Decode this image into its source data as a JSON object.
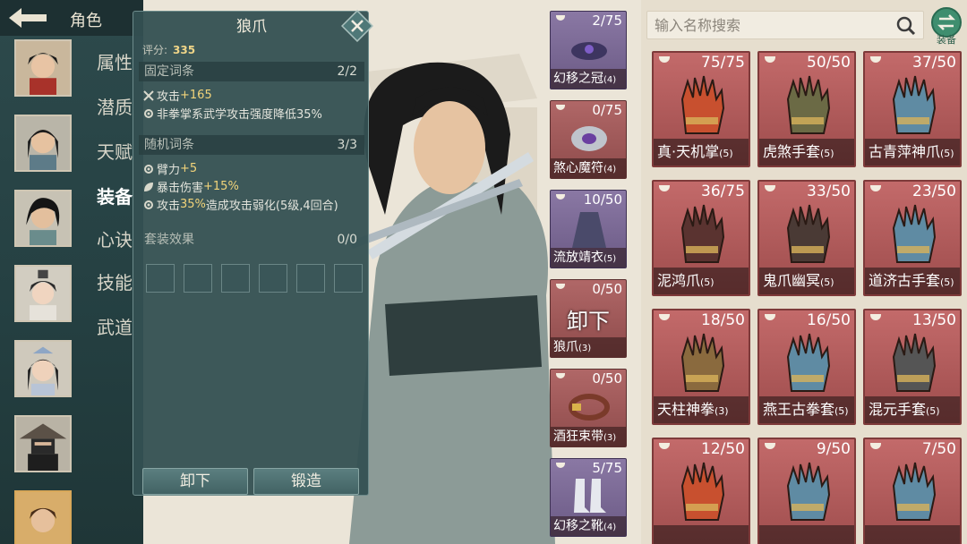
{
  "header": {
    "title": "角色"
  },
  "sidebar": {
    "nav": [
      "属性",
      "潜质",
      "天赋",
      "装备",
      "心诀",
      "技能",
      "武道"
    ],
    "active_index": 3
  },
  "detail": {
    "title": "狼爪",
    "score_label": "评分:",
    "score_value": "335",
    "fixed_header": "固定词条",
    "fixed_count": "2/2",
    "fixed": [
      {
        "prefix": "攻击",
        "value": "+165",
        "suffix": ""
      },
      {
        "prefix": "非拳掌系武学攻击强度降低35%",
        "value": "",
        "suffix": ""
      }
    ],
    "random_header": "随机词条",
    "random_count": "3/3",
    "random": [
      {
        "prefix": "臂力",
        "value": "+5",
        "suffix": ""
      },
      {
        "prefix": "暴击伤害",
        "value": "+15%",
        "suffix": ""
      },
      {
        "prefix": "攻击",
        "value": "35%",
        "suffix": "造成攻击弱化(5级,4回合)"
      }
    ],
    "set_header": "套装效果",
    "set_count": "0/0",
    "buttons": {
      "unequip": "卸下",
      "forge": "锻造"
    }
  },
  "equipped": [
    {
      "name": "幻移之冠",
      "level": "(4)",
      "dur": "2/75",
      "icon": "crown-icon",
      "rarity": "purple"
    },
    {
      "name": "煞心魔符",
      "level": "(4)",
      "dur": "0/75",
      "icon": "talisman-icon",
      "rarity": "red"
    },
    {
      "name": "流放靖衣",
      "level": "(5)",
      "dur": "10/50",
      "icon": "robe-icon",
      "rarity": "purple"
    },
    {
      "name": "狼爪",
      "level": "(3)",
      "dur": "0/50",
      "icon": "claw-icon",
      "rarity": "red",
      "overlay": "卸下"
    },
    {
      "name": "酒狂束带",
      "level": "(3)",
      "dur": "0/50",
      "icon": "belt-icon",
      "rarity": "red"
    },
    {
      "name": "幻移之靴",
      "level": "(4)",
      "dur": "5/75",
      "icon": "boots-icon",
      "rarity": "purple"
    }
  ],
  "search": {
    "placeholder": "输入名称搜索",
    "toggle_label": "装备"
  },
  "inventory": [
    {
      "name": "真·天机掌",
      "level": "(5)",
      "dur": "75/75",
      "color": "#c8502f"
    },
    {
      "name": "虎煞手套",
      "level": "(5)",
      "dur": "50/50",
      "color": "#6b6a45"
    },
    {
      "name": "古青萍神爪",
      "level": "(5)",
      "dur": "37/50",
      "color": "#5f8ba3"
    },
    {
      "name": "泥鸿爪",
      "level": "(5)",
      "dur": "36/75",
      "color": "#5a3330"
    },
    {
      "name": "鬼爪幽冥",
      "level": "(5)",
      "dur": "33/50",
      "color": "#4a3a35"
    },
    {
      "name": "道济古手套",
      "level": "(5)",
      "dur": "23/50",
      "color": "#5f8ba3"
    },
    {
      "name": "天柱神拳",
      "level": "(3)",
      "dur": "18/50",
      "color": "#8a6a3e"
    },
    {
      "name": "燕王古拳套",
      "level": "(5)",
      "dur": "16/50",
      "color": "#5f8ba3"
    },
    {
      "name": "混元手套",
      "level": "(5)",
      "dur": "13/50",
      "color": "#555555"
    },
    {
      "name": "",
      "level": "",
      "dur": "12/50",
      "color": "#c8502f"
    },
    {
      "name": "",
      "level": "",
      "dur": "9/50",
      "color": "#5f8ba3"
    },
    {
      "name": "",
      "level": "",
      "dur": "7/50",
      "color": "#5f8ba3"
    }
  ],
  "colors": {
    "accent_gold": "#f2d47a",
    "panel": "#345052",
    "card_red": "#c36a6a",
    "card_purple": "#8a78a4"
  }
}
